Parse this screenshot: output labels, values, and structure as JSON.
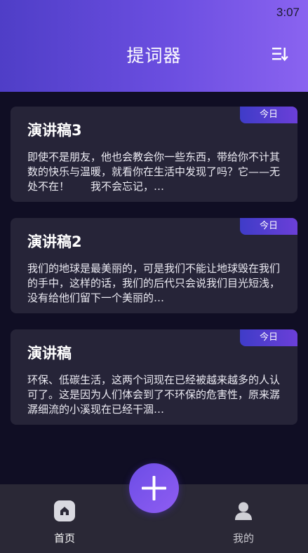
{
  "status_bar": {
    "time": "3:07"
  },
  "header": {
    "title": "提词器",
    "menu_icon": "sort-list-icon"
  },
  "scripts": [
    {
      "title": "演讲稿3",
      "badge": "今日",
      "preview": "即使不是朋友，他也会教会你一些东西，带给你不计其数的快乐与温暖，就看你在生活中发现了吗？它——无处不在！　　我不会忘记，…"
    },
    {
      "title": "演讲稿2",
      "badge": "今日",
      "preview": "我们的地球是最美丽的，可是我们不能让地球毁在我们的手中，这样的话，我们的后代只会说我们目光短浅，没有给他们留下一个美丽的…"
    },
    {
      "title": "演讲稿",
      "badge": "今日",
      "preview": "环保、低碳生活，这两个词现在已经被越来越多的人认可了。这是因为人们体会到了不环保的危害性，原来潺潺细流的小溪现在已经干涸…"
    }
  ],
  "fab": {
    "icon": "plus-icon"
  },
  "bottom_nav": {
    "items": [
      {
        "label": "首页",
        "icon": "home-icon",
        "active": true
      },
      {
        "label": "我的",
        "icon": "user-icon",
        "active": false
      }
    ]
  },
  "colors": {
    "header_gradient_start": "#4f3ec7",
    "header_gradient_end": "#8a63f0",
    "background": "#100e24",
    "card": "#262438",
    "badge_start": "#3f3cc8",
    "badge_end": "#6b3fd8",
    "nav_bar": "#2a2836"
  }
}
